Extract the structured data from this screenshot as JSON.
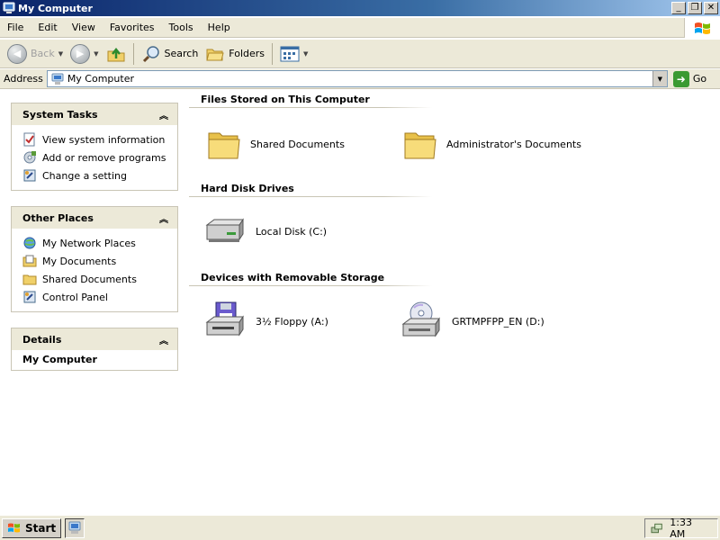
{
  "window": {
    "title": "My Computer",
    "buttons": [
      "minimize",
      "maximize",
      "close"
    ]
  },
  "menu": [
    "File",
    "Edit",
    "View",
    "Favorites",
    "Tools",
    "Help"
  ],
  "toolbar": {
    "back_label": "Back",
    "search_label": "Search",
    "folders_label": "Folders"
  },
  "address": {
    "label": "Address",
    "value": "My Computer",
    "go_label": "Go"
  },
  "sidebar": {
    "system_tasks": {
      "title": "System Tasks",
      "items": [
        {
          "label": "View system information",
          "icon": "system-info-icon"
        },
        {
          "label": "Add or remove programs",
          "icon": "add-remove-programs-icon"
        },
        {
          "label": "Change a setting",
          "icon": "control-panel-icon"
        }
      ]
    },
    "other_places": {
      "title": "Other Places",
      "items": [
        {
          "label": "My Network Places",
          "icon": "network-places-icon"
        },
        {
          "label": "My Documents",
          "icon": "my-documents-icon"
        },
        {
          "label": "Shared Documents",
          "icon": "folder-icon"
        },
        {
          "label": "Control Panel",
          "icon": "control-panel-icon"
        }
      ]
    },
    "details": {
      "title": "Details",
      "value": "My Computer"
    }
  },
  "content": {
    "groups": [
      {
        "title": "Files Stored on This Computer",
        "items": [
          {
            "label": "Shared Documents",
            "icon": "folder-icon"
          },
          {
            "label": "Administrator's Documents",
            "icon": "folder-icon"
          }
        ]
      },
      {
        "title": "Hard Disk Drives",
        "items": [
          {
            "label": "Local Disk (C:)",
            "icon": "hard-disk-icon"
          }
        ]
      },
      {
        "title": "Devices with Removable Storage",
        "items": [
          {
            "label": "3½ Floppy (A:)",
            "icon": "floppy-drive-icon"
          },
          {
            "label": "GRTMPFPP_EN (D:)",
            "icon": "cd-drive-icon"
          }
        ]
      }
    ]
  },
  "taskbar": {
    "start_label": "Start",
    "clock": "1:33 AM"
  },
  "colors": {
    "title_bar": "#0a246a",
    "chrome": "#ece9d8",
    "panel_border": "#c9c5b5",
    "go_green": "#3b9a32"
  }
}
